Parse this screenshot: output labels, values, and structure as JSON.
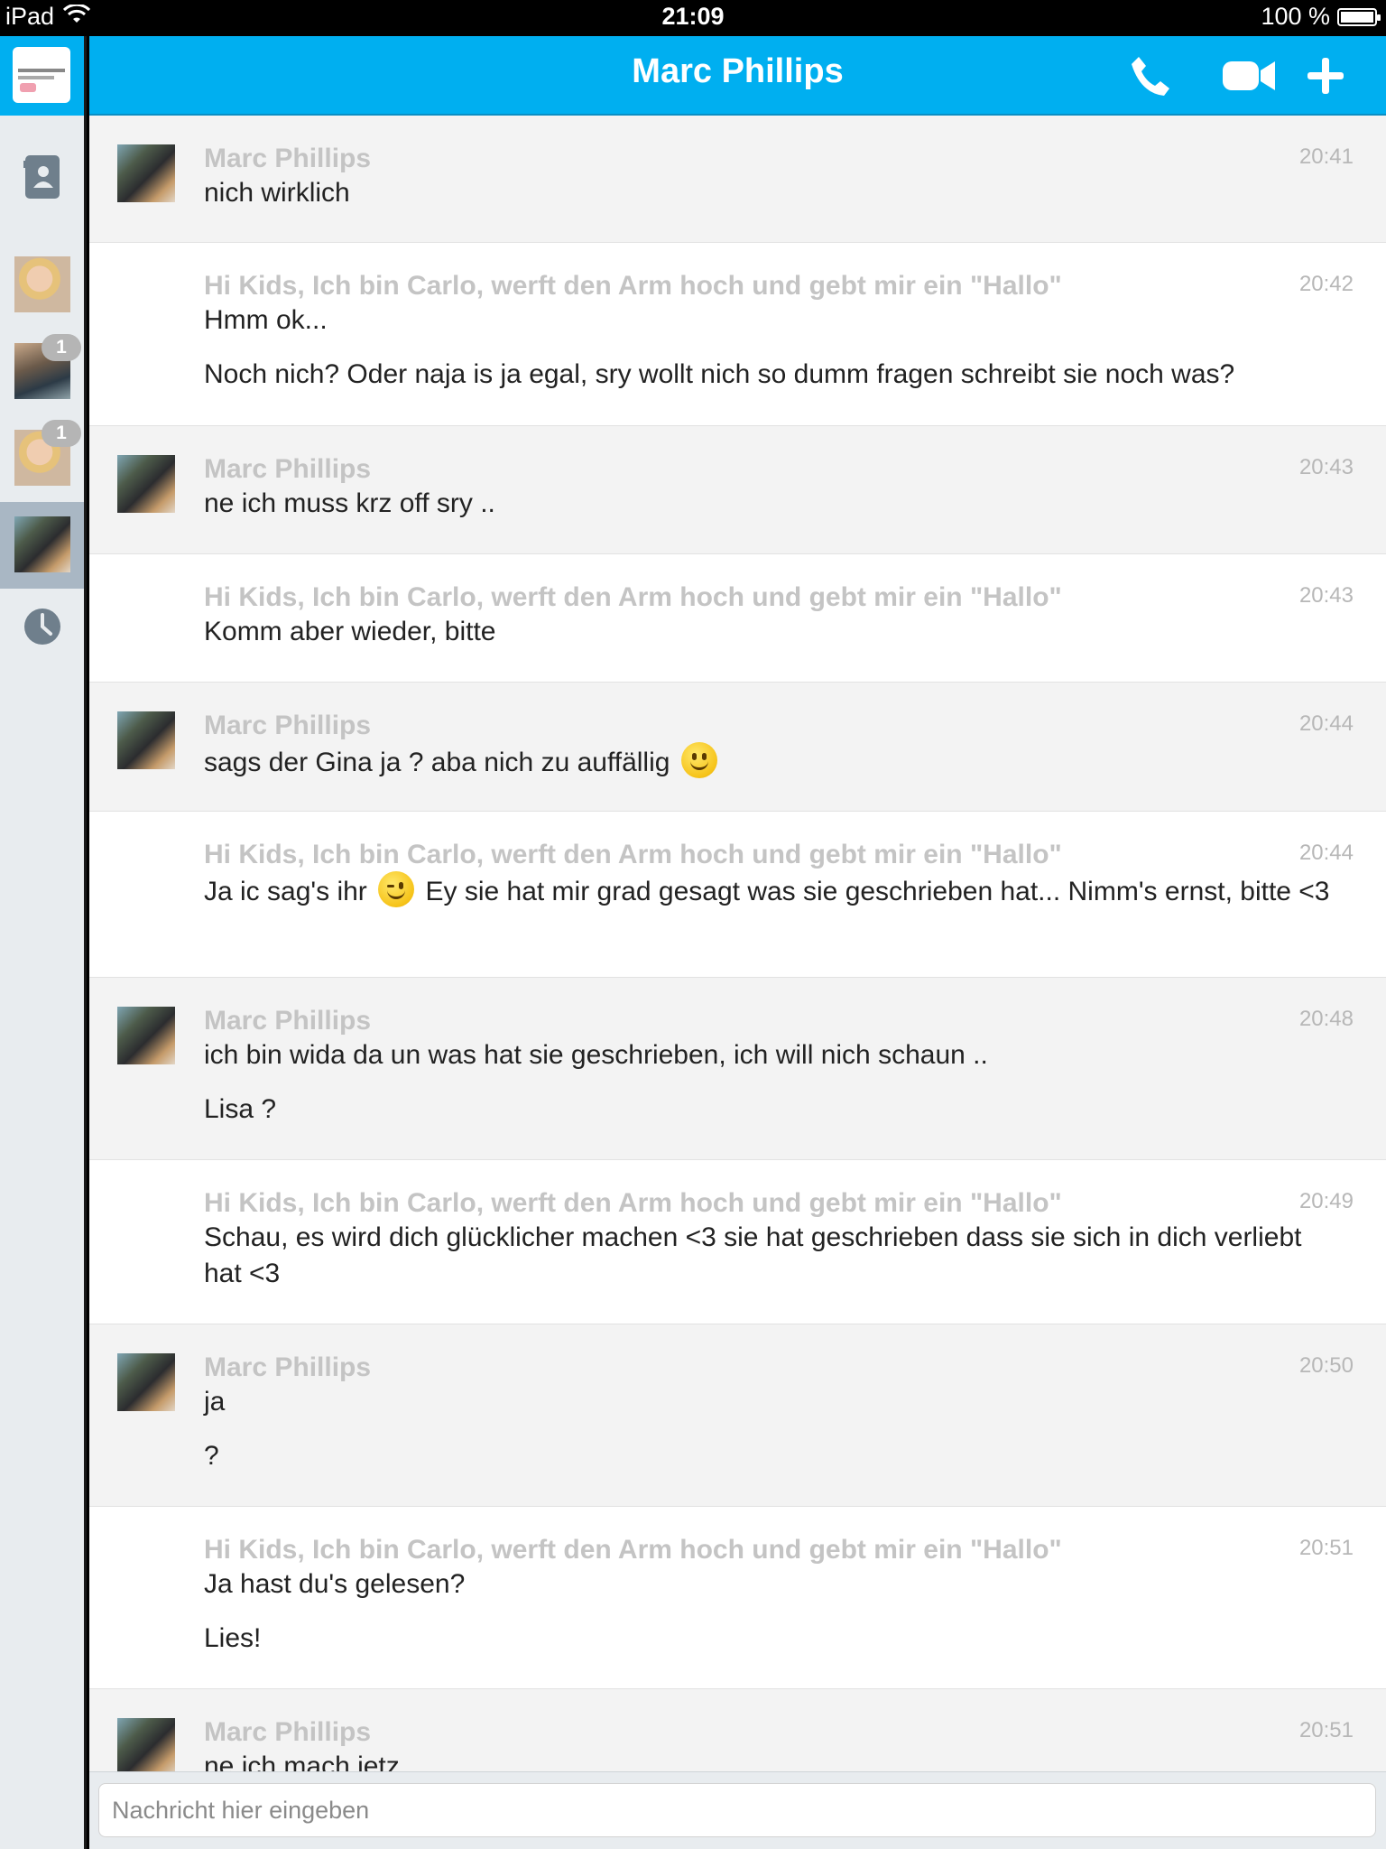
{
  "status_bar": {
    "device": "iPad",
    "time": "21:09",
    "battery": "100 %"
  },
  "header": {
    "title": "Marc Phillips",
    "icons": [
      "phone-icon",
      "video-icon",
      "plus-icon"
    ]
  },
  "sidebar": {
    "items": [
      {
        "name": "contacts-icon"
      },
      {
        "name": "conversation-1",
        "badge": ""
      },
      {
        "name": "conversation-2",
        "badge": "1"
      },
      {
        "name": "conversation-3",
        "badge": "1"
      },
      {
        "name": "conversation-marc-selected",
        "badge": ""
      },
      {
        "name": "recent-icon"
      }
    ]
  },
  "messages": [
    {
      "sender": "Marc Phillips",
      "time": "20:41",
      "lines": [
        "nich wirklich"
      ]
    },
    {
      "sender": "Hi Kids, Ich bin Carlo, werft den Arm hoch und gebt mir ein \"Hallo\"",
      "time": "20:42",
      "lines": [
        "Hmm ok...",
        "Noch nich? Oder naja is ja egal, sry wollt nich so dumm fragen schreibt sie noch was?"
      ]
    },
    {
      "sender": "Marc Phillips",
      "time": "20:43",
      "lines": [
        "ne ich muss krz off sry .."
      ]
    },
    {
      "sender": "Hi Kids, Ich bin Carlo, werft den Arm hoch und gebt mir ein \"Hallo\"",
      "time": "20:43",
      "lines": [
        "Komm aber wieder, bitte"
      ]
    },
    {
      "sender": "Marc Phillips",
      "time": "20:44",
      "lines": [
        "sags der Gina ja ? aba nich zu auffällig"
      ]
    },
    {
      "sender": "Hi Kids, Ich bin Carlo, werft den Arm hoch und gebt mir ein \"Hallo\"",
      "time": "20:44",
      "line_a": "Ja ic sag's ihr",
      "line_b": "Ey sie hat mir grad gesagt was sie geschrieben hat... Nimm's ernst, bitte <3"
    },
    {
      "sender": "Marc Phillips",
      "time": "20:48",
      "lines": [
        "ich bin wida da un was hat sie geschrieben, ich will nich schaun ..",
        "Lisa ?"
      ]
    },
    {
      "sender": "Hi Kids, Ich bin Carlo, werft den Arm hoch und gebt mir ein \"Hallo\"",
      "time": "20:49",
      "lines": [
        "Schau, es wird dich glücklicher machen <3 sie hat geschrieben dass sie sich in dich verliebt hat <3"
      ]
    },
    {
      "sender": "Marc Phillips",
      "time": "20:50",
      "lines": [
        "ja",
        "?"
      ]
    },
    {
      "sender": "Hi Kids, Ich bin Carlo, werft den Arm hoch und gebt mir ein \"Hallo\"",
      "time": "20:51",
      "lines": [
        "Ja hast du's gelesen?",
        "Lies!"
      ]
    },
    {
      "sender": "Marc Phillips",
      "time": "20:51",
      "lines": [
        "ne ich mach jetz"
      ]
    }
  ],
  "input": {
    "placeholder": "Nachricht hier eingeben",
    "value": ""
  }
}
